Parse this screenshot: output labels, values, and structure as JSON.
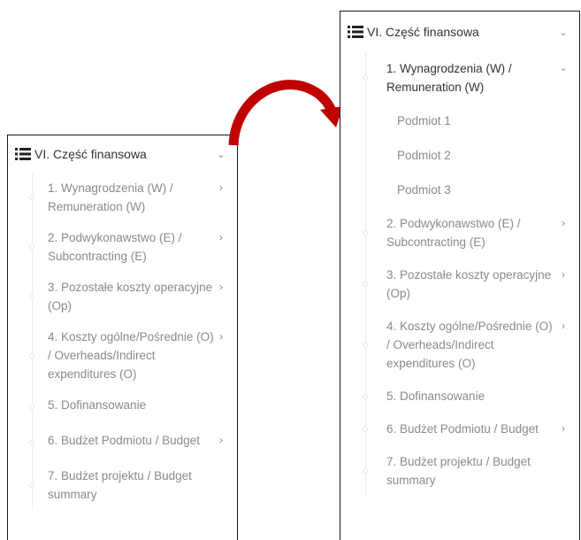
{
  "colors": {
    "arrow": "#c00000",
    "panel_border": "#1a1a1a",
    "header_text": "#333333",
    "item_text": "#8a8a8a",
    "chevron": "#888888"
  },
  "left_panel": {
    "header": {
      "icon": "list-icon",
      "title": "VI. Część finansowa",
      "chevron": "⌄"
    },
    "items": [
      {
        "label": "1. Wynagrodzenia (W) / Remuneration (W)",
        "chevron": "›"
      },
      {
        "label": "2. Podwykonawstwo (E) / Subcontracting (E)",
        "chevron": "›"
      },
      {
        "label": "3. Pozostałe koszty operacyjne (Op)",
        "chevron": "›"
      },
      {
        "label": "4. Koszty ogólne/Pośrednie (O) / Overheads/Indirect expenditures (O)",
        "chevron": "›"
      },
      {
        "label": "5. Dofinansowanie",
        "chevron": ""
      },
      {
        "label": "6. Budżet Podmiotu / Budget",
        "chevron": "›"
      },
      {
        "label": "7. Budżet projektu / Budget summary",
        "chevron": ""
      }
    ]
  },
  "right_panel": {
    "header": {
      "icon": "list-icon",
      "title": "VI. Część finansowa",
      "chevron": "⌄"
    },
    "expanded_item": {
      "label": "1. Wynagrodzenia (W) / Remuneration (W)",
      "chevron": "⌄",
      "sub_items": [
        "Podmiot 1",
        "Podmiot 2",
        "Podmiot 3"
      ]
    },
    "items": [
      {
        "label": "2. Podwykonawstwo (E) / Subcontracting (E)",
        "chevron": "›"
      },
      {
        "label": "3. Pozostałe koszty operacyjne (Op)",
        "chevron": "›"
      },
      {
        "label": "4. Koszty ogólne/Pośrednie (O) / Overheads/Indirect expenditures (O)",
        "chevron": "›"
      },
      {
        "label": "5. Dofinansowanie",
        "chevron": ""
      },
      {
        "label": "6. Budżet Podmiotu / Budget",
        "chevron": "›"
      },
      {
        "label": "7. Budżet projektu / Budget summary",
        "chevron": ""
      }
    ]
  }
}
